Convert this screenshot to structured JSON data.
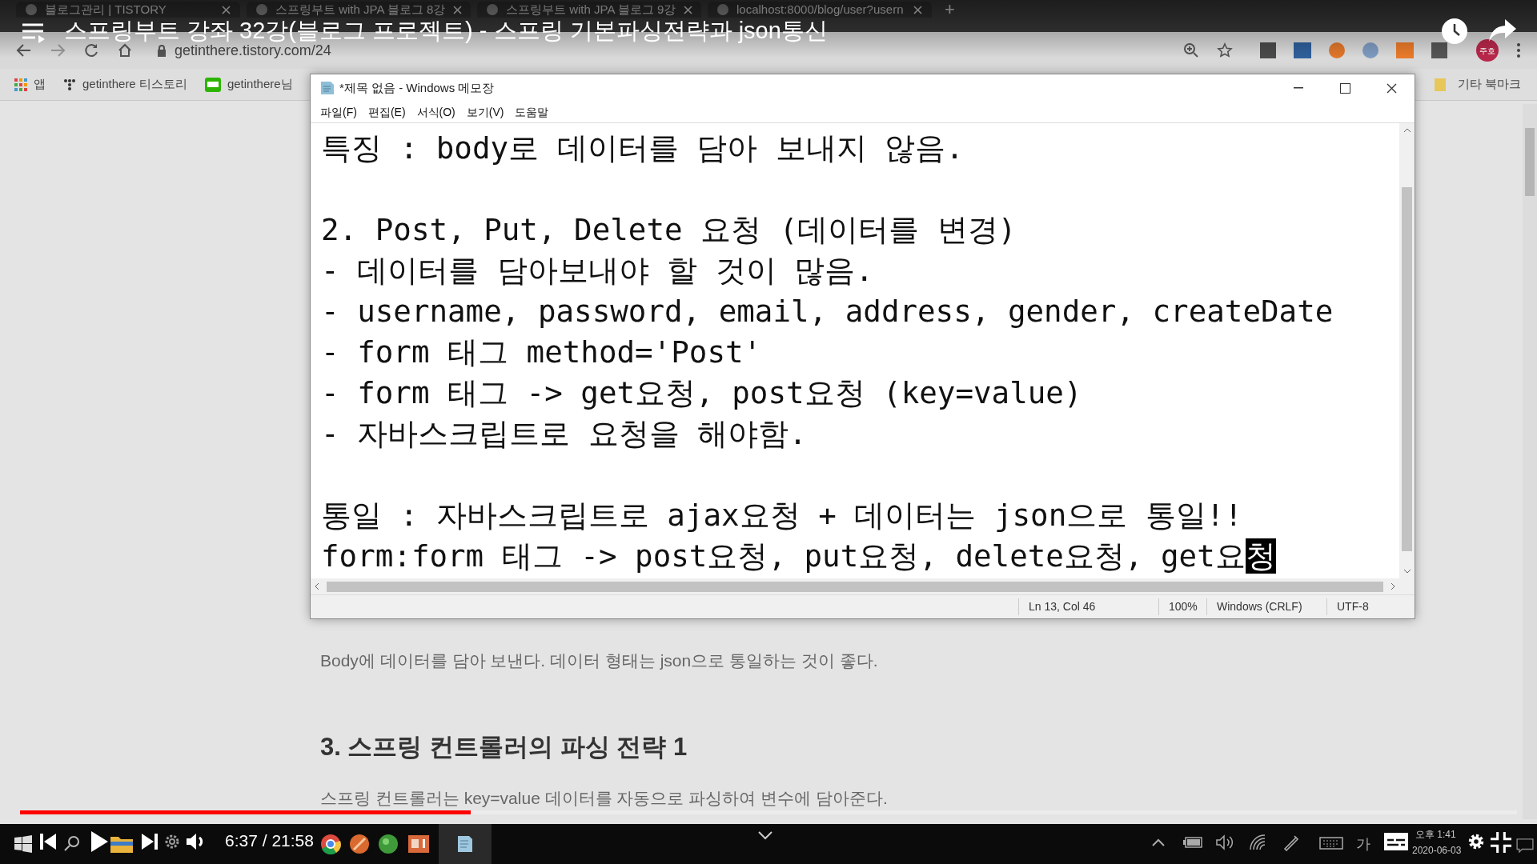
{
  "player": {
    "title": "스프링부트 강좌 32강(블로그 프로젝트) - 스프링 기본파싱전략과 json통신",
    "time": "6:37 / 21:58",
    "progress": {
      "level": 0.301
    }
  },
  "browser": {
    "tabs": [
      {
        "label": "블로그관리 | TISTORY"
      },
      {
        "label": "스프링부트 with JPA 블로그 8강"
      },
      {
        "label": "스프링부트 with JPA 블로그 9강"
      },
      {
        "label": "localhost:8000/blog/user?usern"
      }
    ],
    "new_tab": "+",
    "address": "getinthere.tistory.com/24",
    "profile": "주호",
    "bookmarks": [
      {
        "label": "앱",
        "kind": "apps"
      },
      {
        "label": "getinthere 티스토리",
        "kind": "tistory"
      },
      {
        "label": "getinthere님",
        "kind": "blog"
      }
    ],
    "other_bookmarks": "기타 북마크"
  },
  "notepad": {
    "title": "*제목 없음 - Windows 메모장",
    "menu": [
      "파일(F)",
      "편집(E)",
      "서식(O)",
      "보기(V)",
      "도움말"
    ],
    "paragraphs": [
      [
        {
          "text": "특징 : body로 데이터를 담아 보내지 않음."
        }
      ],
      [
        {
          "text": "2. Post, Put, Delete 요청 (데이터를 변경)"
        },
        {
          "text": "- 데이터를 담아보내야 할 것이 많음."
        },
        {
          "text": "- username, password, email, address, gender, createDate"
        },
        {
          "text": "- form 태그 method='Post'"
        },
        {
          "text": "- form 태그 -> get요청, post요청 (key=value)"
        },
        {
          "text": "- 자바스크립트로 요청을 해야함."
        }
      ],
      [
        {
          "text": "통일 : 자바스크립트로 ajax요청 + 데이터는 json으로 통일!!"
        },
        {
          "text": "form:form 태그 -> post요청, put요청, delete요청, get요",
          "selection": "청"
        }
      ]
    ],
    "status": [
      "Ln 13, Col 46",
      "100%",
      "Windows (CRLF)",
      "UTF-8"
    ]
  },
  "article": {
    "paragraph": "Body에 데이터를 담아 보낸다. 데이터 형태는 json으로 통일하는 것이 좋다.",
    "heading": "3. 스프링 컨트롤러의 파싱 전략 1",
    "paragraph_2": "스프링 컨트롤러는 key=value 데이터를 자동으로 파싱하여 변수에 담아준다."
  },
  "taskbar": {
    "ime": "가",
    "clock_time": "오후 1:41",
    "clock_date": "2020-06-03"
  }
}
